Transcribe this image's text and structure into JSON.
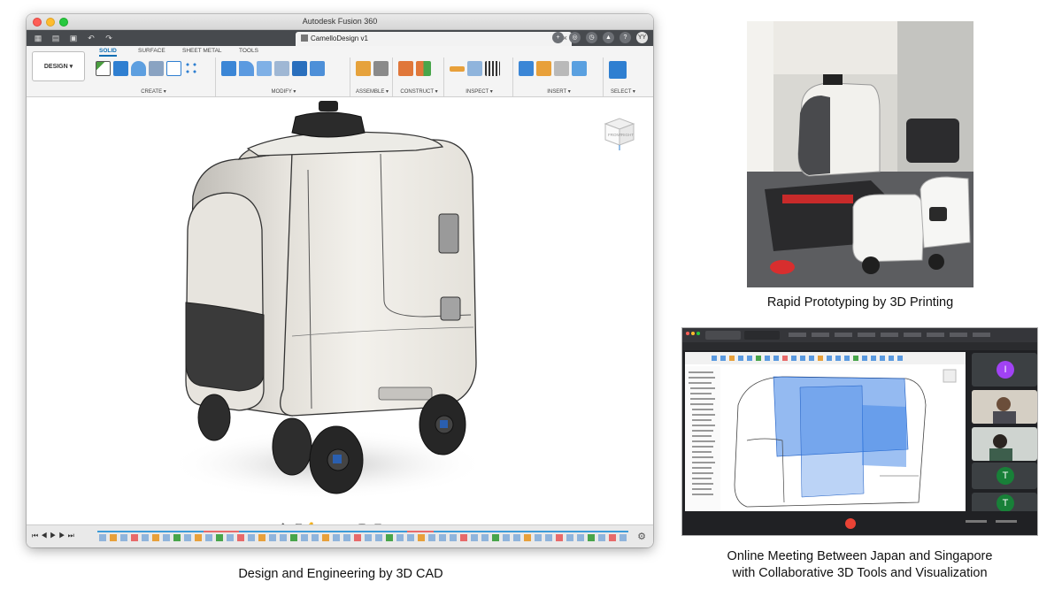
{
  "fusion": {
    "window_title": "Autodesk Fusion 360",
    "doc_tab": "CamelloDesign v1",
    "avatar": "YY",
    "workspace": "DESIGN",
    "tabs": [
      "SOLID",
      "SURFACE",
      "SHEET METAL",
      "TOOLS"
    ],
    "groups": [
      "CREATE",
      "MODIFY",
      "ASSEMBLE",
      "CONSTRUCT",
      "INSPECT",
      "INSERT",
      "SELECT"
    ],
    "viewcube": {
      "front": "FRONT",
      "right": "RIGHT"
    }
  },
  "captions": {
    "cad": "Design and Engineering by 3D CAD",
    "print": "Rapid Prototyping by 3D Printing",
    "meeting_line1": "Online Meeting Between Japan and Singapore",
    "meeting_line2": "with Collaborative 3D Tools and Visualization"
  },
  "meeting": {
    "participants": [
      {
        "initial": "I",
        "color": "#a142f4"
      },
      {
        "initial": "T",
        "color": "#188038"
      },
      {
        "initial": "T",
        "color": "#188038"
      }
    ]
  },
  "colors": {
    "accent": "#0f6fb4",
    "robot_body": "#efece6",
    "robot_dark": "#3a3a3a"
  }
}
